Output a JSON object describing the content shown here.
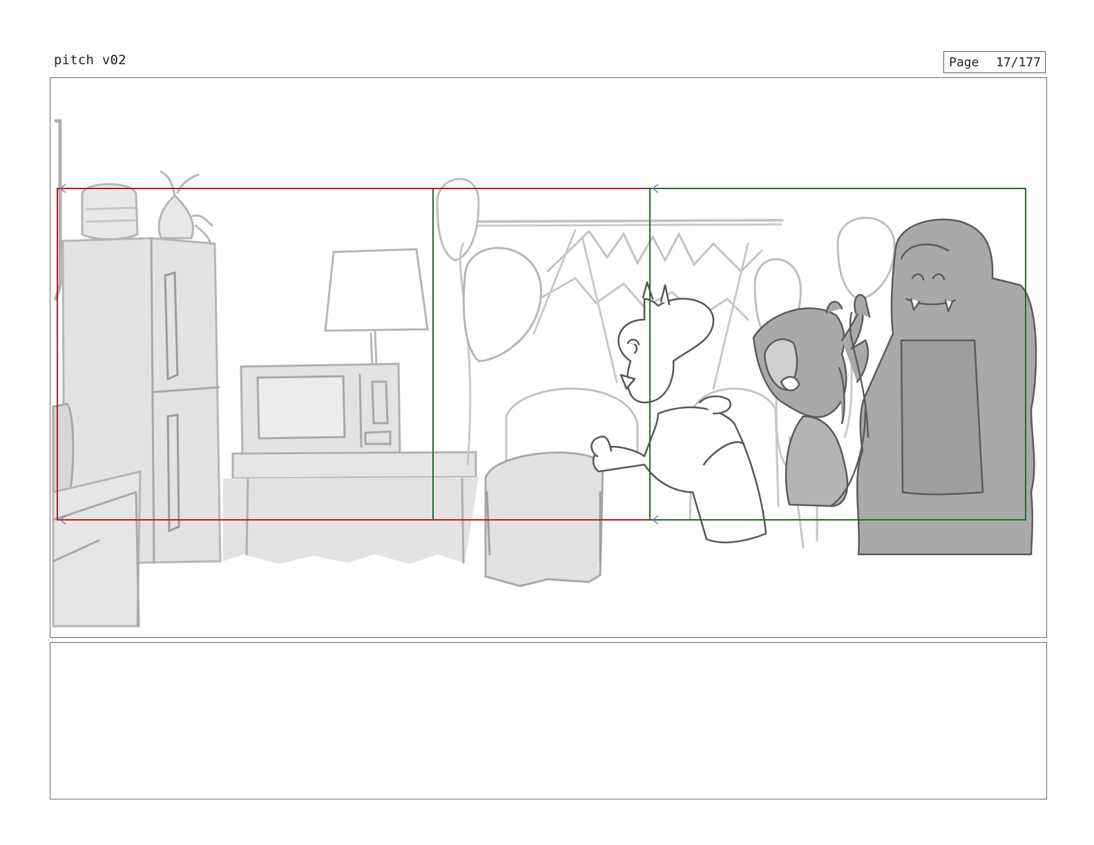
{
  "header": {
    "title": "pitch v02",
    "page_label": "Page",
    "page_number": "17/177"
  },
  "panel": {
    "frames": [
      {
        "name": "camera-frame-start",
        "color": "#b01c1c"
      },
      {
        "name": "camera-frame-end",
        "color": "#1e6b2e"
      }
    ],
    "sketch_colors": {
      "light_line": "#b8b8b8",
      "fill": "#e2e2e2",
      "dark_line": "#555555",
      "character_fill": "#a9a9a9"
    }
  },
  "notes": {
    "text": ""
  }
}
